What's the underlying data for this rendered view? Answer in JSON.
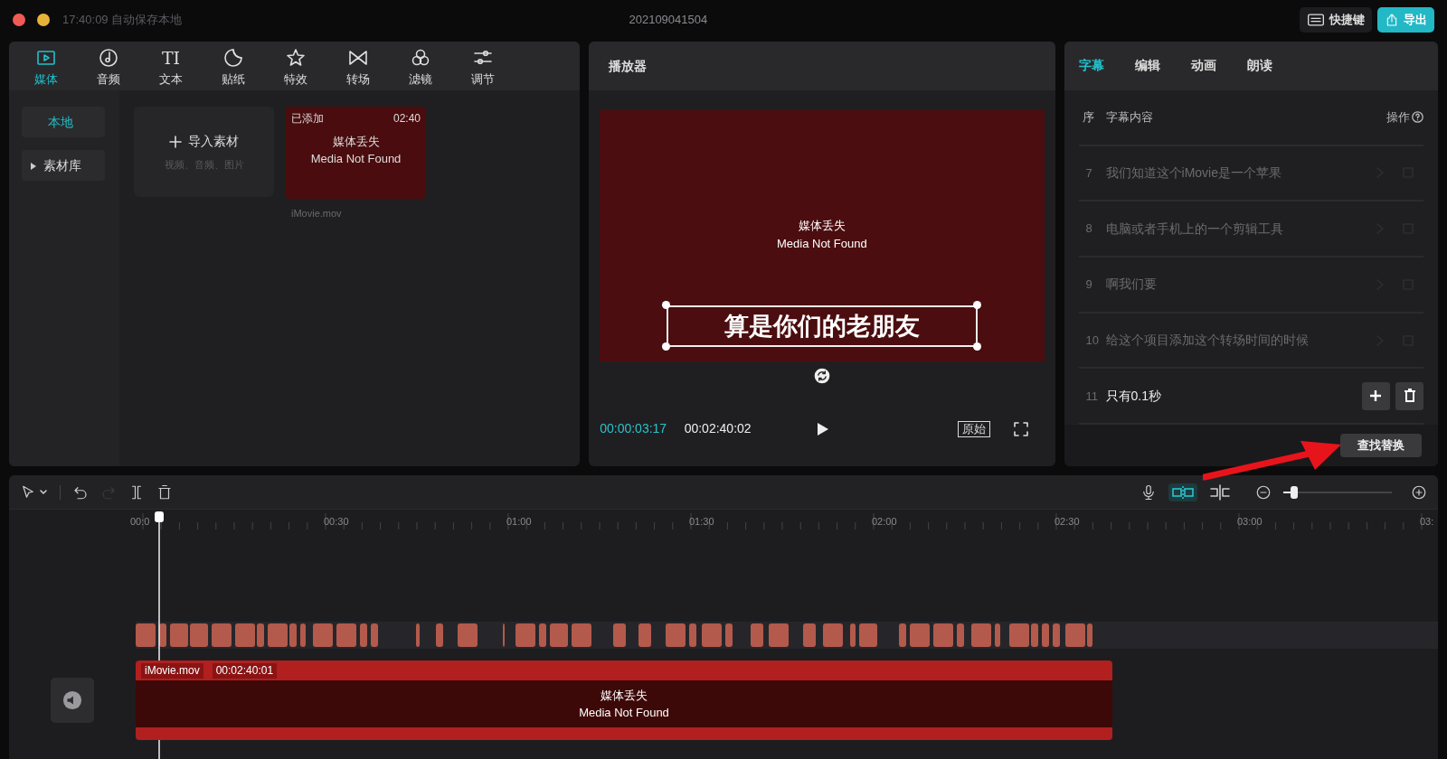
{
  "titlebar": {
    "status": "17:40:09 自动保存本地",
    "project": "202109041504",
    "buttons": [
      {
        "kind": "shortcuts",
        "label": "快捷键"
      },
      {
        "kind": "export",
        "label": "导出"
      }
    ]
  },
  "media_panel": {
    "tabs": [
      {
        "label": "媒体",
        "selected": true
      },
      {
        "label": "音频",
        "selected": false
      },
      {
        "label": "文本",
        "selected": false,
        "glyph": "TI"
      },
      {
        "label": "贴纸",
        "selected": false
      },
      {
        "label": "特效",
        "selected": false
      },
      {
        "label": "转场",
        "selected": false
      },
      {
        "label": "滤镜",
        "selected": false
      },
      {
        "label": "调节",
        "selected": false
      }
    ],
    "sidebar": [
      {
        "label": "本地",
        "selected": true
      },
      {
        "label": "素材库",
        "selected": false,
        "expandable": true
      }
    ],
    "import": {
      "label": "导入素材",
      "hint": "视频、音频、图片"
    },
    "clips": [
      {
        "badge": "已添加",
        "duration": "02:40",
        "status": "媒体丢失",
        "status_en": "Media Not Found",
        "filename": "iMovie.mov"
      }
    ]
  },
  "player": {
    "title": "播放器",
    "status": "媒体丢失",
    "status_en": "Media Not Found",
    "caption": "算是你们的老朋友",
    "current_time": "00:00:03:17",
    "total_time": "00:02:40:02",
    "ratio_button": "原始"
  },
  "subtitle_panel": {
    "tabs": [
      {
        "label": "字幕",
        "selected": true
      },
      {
        "label": "编辑",
        "selected": false
      },
      {
        "label": "动画",
        "selected": false
      },
      {
        "label": "朗读",
        "selected": false
      }
    ],
    "columns": [
      "序",
      "字幕内容",
      "操作"
    ],
    "rows": [
      {
        "number": "7",
        "text": "我们知道这个iMovie是一个苹果",
        "selected": false
      },
      {
        "number": "8",
        "text": "电脑或者手机上的一个剪辑工具",
        "selected": false
      },
      {
        "number": "9",
        "text": "啊我们要",
        "selected": false
      },
      {
        "number": "10",
        "text": "给这个项目添加这个转场时间的时候",
        "selected": false
      },
      {
        "number": "11",
        "text": "只有0.1秒",
        "selected": true
      }
    ],
    "find_replace": "查找替换"
  },
  "timeline": {
    "redo_disabled": true,
    "snap_on": true,
    "zoom": {
      "level": 0.1
    },
    "ruler": [
      "00:0",
      "00:30",
      "01:00",
      "01:30",
      "02:00",
      "02:30",
      "03:00",
      "03:"
    ],
    "main_clip": {
      "name": "iMovie.mov",
      "duration": "00:02:40:01",
      "status": "媒体丢失",
      "status_en": "Media Not Found"
    }
  }
}
